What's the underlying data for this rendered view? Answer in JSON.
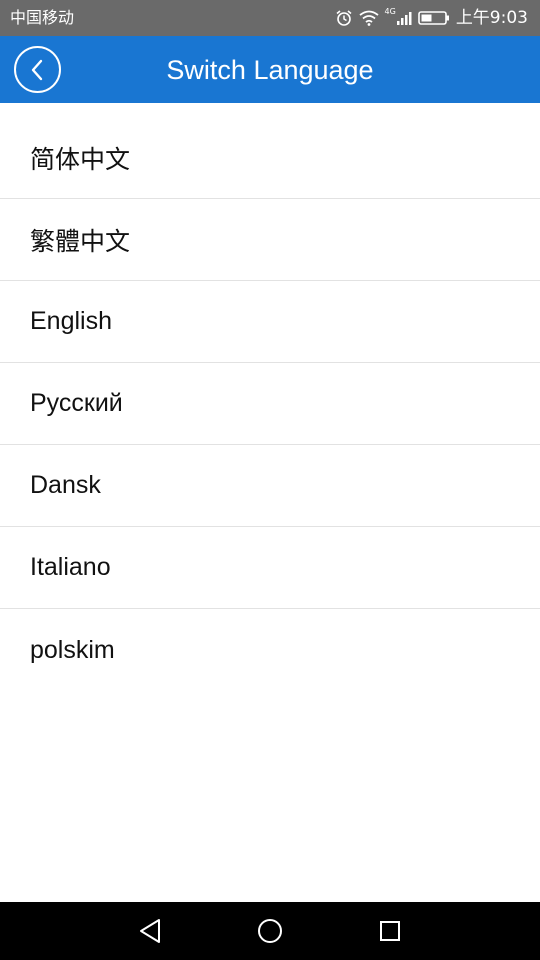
{
  "status_bar": {
    "carrier": "中国移动",
    "network_label": "4G",
    "time": "上午9:03",
    "icons": [
      "alarm-icon",
      "wifi-icon",
      "signal-icon",
      "battery-icon"
    ]
  },
  "header": {
    "title": "Switch Language",
    "background_color": "#1976d2"
  },
  "languages": [
    {
      "label": "简体中文"
    },
    {
      "label": "繁體中文"
    },
    {
      "label": "English"
    },
    {
      "label": "Русский"
    },
    {
      "label": "Dansk"
    },
    {
      "label": "Italiano"
    },
    {
      "label": "polskim"
    }
  ],
  "nav_bar": {
    "icons": [
      "back-triangle-icon",
      "home-circle-icon",
      "recents-square-icon"
    ]
  }
}
